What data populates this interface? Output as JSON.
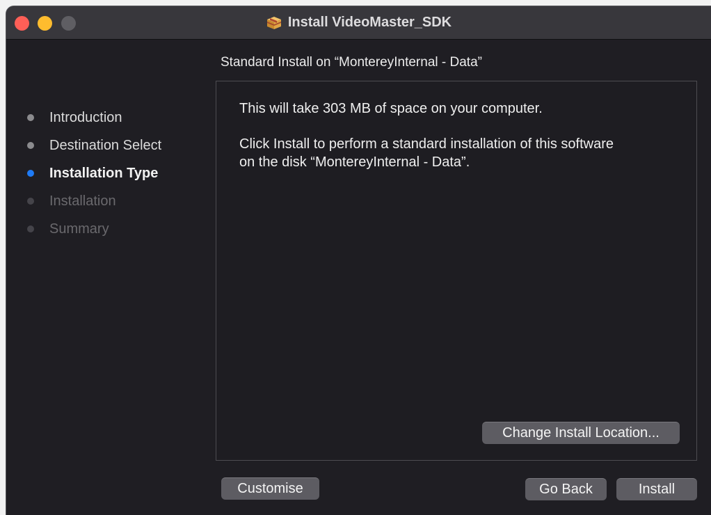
{
  "window": {
    "title": "Install VideoMaster_SDK"
  },
  "header": {
    "subtitle": "Standard Install on “MontereyInternal - Data”"
  },
  "sidebar": {
    "steps": [
      {
        "label": "Introduction",
        "state": "done"
      },
      {
        "label": "Destination Select",
        "state": "done"
      },
      {
        "label": "Installation Type",
        "state": "current"
      },
      {
        "label": "Installation",
        "state": "todo"
      },
      {
        "label": "Summary",
        "state": "todo"
      }
    ]
  },
  "content": {
    "space_text": "This will take 303 MB of space on your computer.",
    "instruction_line1": "Click Install to perform a standard installation of this software",
    "instruction_line2": "on the disk “MontereyInternal - Data”.",
    "change_location_label": "Change Install Location..."
  },
  "footer": {
    "customise_label": "Customise",
    "go_back_label": "Go Back",
    "install_label": "Install"
  },
  "colors": {
    "accent": "#1f7bf6",
    "close": "#fe5f57",
    "minimize": "#febc2e"
  },
  "icons": {
    "title_icon": "package-icon"
  }
}
